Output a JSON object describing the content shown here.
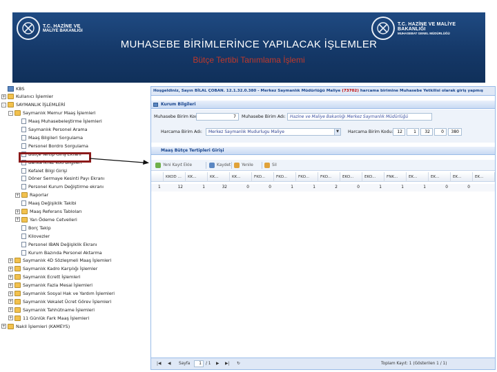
{
  "header": {
    "logo_left_line1": "T.C. HAZİNE VE",
    "logo_left_line2": "MALİYE BAKANLIĞI",
    "logo_right_line1": "T.C. HAZİNE VE MALİYE BAKANLIĞI",
    "logo_right_line2": "MUHASEBAT GENEL MÜDÜRLÜĞÜ",
    "title": "MUHASEBE BİRİMLERİNCE YAPILACAK İŞLEMLER",
    "subtitle": "Bütçe Tertibi Tanımlama İşlemi"
  },
  "tree": {
    "items": [
      {
        "label": "KBS",
        "level": 0,
        "kind": "root",
        "expander": ""
      },
      {
        "label": "Kullanıcı İşlemler",
        "level": 0,
        "kind": "folder",
        "expander": "+"
      },
      {
        "label": "SAYMANLIK İŞLEMLERİ",
        "level": 0,
        "kind": "folder",
        "expander": "-"
      },
      {
        "label": "Saymanlık Memur Maaş İşlemleri",
        "level": 1,
        "kind": "folder",
        "expander": "-"
      },
      {
        "label": "Maaş Muhasebeleştirme İşlemleri",
        "level": 2,
        "kind": "doc",
        "expander": ""
      },
      {
        "label": "Saymanlık Personel Arama",
        "level": 2,
        "kind": "doc",
        "expander": ""
      },
      {
        "label": "Maaş Bilgileri Sorgulama",
        "level": 2,
        "kind": "doc",
        "expander": ""
      },
      {
        "label": "Personel Bordro Sorgulama",
        "level": 2,
        "kind": "doc",
        "expander": ""
      },
      {
        "label": "Bütçe Tertip Giriş Ekranı",
        "level": 2,
        "kind": "doc",
        "expander": ""
      },
      {
        "label": "Banka İkraz Kod Bilgileri",
        "level": 2,
        "kind": "doc",
        "expander": ""
      },
      {
        "label": "Kefalet Bilgi Girişi",
        "level": 2,
        "kind": "doc",
        "expander": ""
      },
      {
        "label": "Döner Sermaye Kesinti Payı Ekranı",
        "level": 2,
        "kind": "doc",
        "expander": ""
      },
      {
        "label": "Personel Kurum Değiştirme ekranı",
        "level": 2,
        "kind": "doc",
        "expander": ""
      },
      {
        "label": "Raporlar",
        "level": 2,
        "kind": "folder",
        "expander": "+"
      },
      {
        "label": "Maaş Değişiklik Takibi",
        "level": 2,
        "kind": "doc",
        "expander": ""
      },
      {
        "label": "Maaş Referans Tabloları",
        "level": 2,
        "kind": "folder",
        "expander": "+"
      },
      {
        "label": "Yan Ödeme Cetvelleri",
        "level": 2,
        "kind": "folder",
        "expander": "+"
      },
      {
        "label": "Borç Takip",
        "level": 2,
        "kind": "doc",
        "expander": ""
      },
      {
        "label": "Kilovezler",
        "level": 2,
        "kind": "doc",
        "expander": ""
      },
      {
        "label": "Personel IBAN Değişiklik Ekranı",
        "level": 2,
        "kind": "doc",
        "expander": ""
      },
      {
        "label": "Kurum Bazında Personel Aktarma",
        "level": 2,
        "kind": "doc",
        "expander": ""
      },
      {
        "label": "Saymanlık 4D Sözleşmeli Maaş İşlemleri",
        "level": 1,
        "kind": "folder",
        "expander": "+"
      },
      {
        "label": "Saymanlık Kadro Karşılığı İşlemler",
        "level": 1,
        "kind": "folder",
        "expander": "+"
      },
      {
        "label": "Saymanlık Ecrett İşlemleri",
        "level": 1,
        "kind": "folder",
        "expander": "+"
      },
      {
        "label": "Saymanlık Fazla Mesai İşlemleri",
        "level": 1,
        "kind": "folder",
        "expander": "+"
      },
      {
        "label": "Saymanlık Sosyal Hak ve Yardım İşlemleri",
        "level": 1,
        "kind": "folder",
        "expander": "+"
      },
      {
        "label": "Saymanlık Vekalet Ücret Görev İşlemleri",
        "level": 1,
        "kind": "folder",
        "expander": "+"
      },
      {
        "label": "Saymanlık Tahhütname İşlemleri",
        "level": 1,
        "kind": "folder",
        "expander": "+"
      },
      {
        "label": "11 Günlük Fark Maaş İşlemleri",
        "level": 1,
        "kind": "folder",
        "expander": "+"
      },
      {
        "label": "Nakil İşlemleri (KAMEYS)",
        "level": 0,
        "kind": "folder",
        "expander": "+"
      }
    ]
  },
  "panel": {
    "welcome_prefix": "Hoşgeldiniz, Sayın BİLAL ÇOBAN. 12.1.32.0.380 - Merkez Saymanlık Müdürlüğü Maliye",
    "welcome_code": "(73702)",
    "welcome_suffix": "harcama birimine Muhasebe Yetkilisi olarak giriş yapmış",
    "kurum_title": "Kurum Bilgileri",
    "muhasebe_kodu_label": "Muhasebe Birim Kodu:",
    "muhasebe_kodu_value": "7",
    "muhasebe_adi_label": "Muhasebe Birim Adı:",
    "muhasebe_adi_value": "Hazine ve Maliye Bakanlığı Merkez Saymanlık Müdürlüğü",
    "harcama_adi_label": "Harcama Birim Adı:",
    "harcama_adi_value": "Merkez Saymanlık Mudurlugu Maliye",
    "harcama_kodu_label": "Harcama Birim Kodu:",
    "harcama_kodu_values": [
      "12",
      "1",
      "32",
      "0",
      "380"
    ],
    "grid_title": "Maaş Bütçe Tertipleri Girişi",
    "toolbar": {
      "new_label": "Yeni Kayıt Ekle",
      "save_label": "Kaydet",
      "refresh_label": "Yenile",
      "delete_label": "Sil"
    },
    "columns": [
      "KKOD ...",
      "KK...",
      "KK...",
      "KK...",
      "FKO...",
      "FKO...",
      "FKO...",
      "FKO...",
      "EKO...",
      "EKO...",
      "FNK...",
      "EK...",
      "EK...",
      "EK...",
      "EK..."
    ],
    "row": [
      "1",
      "12",
      "1",
      "32",
      "0",
      "0",
      "1",
      "1",
      "2",
      "0",
      "1",
      "1",
      "1",
      "0",
      "0"
    ],
    "pager": {
      "page_label": "Sayfa",
      "page_value": "1",
      "page_of": "/ 1",
      "total_label": "Toplam Kayıt: 1 (Gösterilen 1 / 1)"
    }
  },
  "colors": {
    "banner": "#143766",
    "subtitle_red": "#c0392b",
    "highlight_border": "#8b1a1a",
    "panel_border": "#99bbe8"
  }
}
